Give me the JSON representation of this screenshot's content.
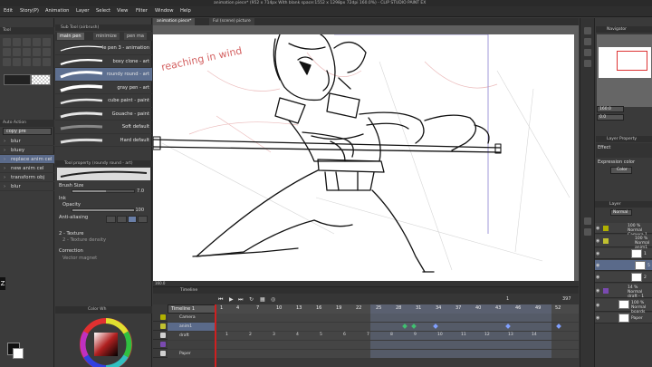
{
  "window": {
    "title": "animation piece* (952 x 714px With blank space:1552 x 1298px 72dpi 160.0%) - CLIP STUDIO PAINT EX"
  },
  "menu": [
    "Edit",
    "Story(P)",
    "Animation",
    "Layer",
    "Select",
    "View",
    "Filter",
    "Window",
    "Help"
  ],
  "tool_panel": {
    "header": "Tool",
    "subtool_header": "Auto Action",
    "subtool_dropdown": "copy pre",
    "items": [
      {
        "label": "blur",
        "selected": false
      },
      {
        "label": "bluey",
        "selected": false
      },
      {
        "label": "replace anim cel",
        "selected": true
      },
      {
        "label": "new anim cel",
        "selected": false
      },
      {
        "label": "transform obj",
        "selected": false
      },
      {
        "label": "blur",
        "selected": false
      }
    ],
    "shortcut_key": "Z"
  },
  "brush_panel": {
    "header": "Sub Tool (airbrush)",
    "tabs": [
      {
        "label": "main pen",
        "selected": true
      },
      {
        "label": "minimize",
        "selected": false
      },
      {
        "label": "pen ma",
        "selected": false
      }
    ],
    "brushes": [
      {
        "label": "le pen 3 - animation",
        "selected": false
      },
      {
        "label": "boxy clone - art",
        "selected": false
      },
      {
        "label": "roundy round - art",
        "selected": true
      },
      {
        "label": "gray pen - art",
        "selected": false
      },
      {
        "label": "cube paint - paint",
        "selected": false
      },
      {
        "label": "Gouache - paint",
        "selected": false
      },
      {
        "label": "Soft default",
        "selected": false
      },
      {
        "label": "Hard default",
        "selected": false
      }
    ]
  },
  "tool_property": {
    "header": "Tool property (roundy round - art)",
    "brush_size_label": "Brush Size",
    "brush_size_value": "7.0",
    "brush_size_fraction": 0.55,
    "ink_label": "Ink",
    "opacity_label": "Opacity",
    "opacity_value": "100",
    "opacity_fraction": 1.0,
    "anti_alias_label": "Anti-aliasing",
    "texture_label": "2 - Texture",
    "texture_density_label": "2 - Texture density",
    "correction_label": "Correction",
    "vector_magnet_label": "Vector magnet"
  },
  "color_wheel": {
    "header": "Color Wh"
  },
  "document_tabs": [
    {
      "label": "animation piece*",
      "selected": true
    },
    {
      "label": "Ful (scene) picture",
      "selected": false
    }
  ],
  "canvas": {
    "zoom": "160.0",
    "handwritten_note": "reaching in wind"
  },
  "timeline": {
    "header": "Timeline",
    "selected_timeline": "Timeline 1",
    "current_frame": "1",
    "total_frames": "397",
    "frame_marks": [
      "1",
      "4",
      "7",
      "10",
      "13",
      "16",
      "19",
      "22",
      "25",
      "28",
      "31",
      "34",
      "37",
      "40",
      "43",
      "46",
      "49",
      "52"
    ],
    "tracks": [
      {
        "name": "Camera",
        "selected": false,
        "badge_color": "#b0b000"
      },
      {
        "name": "anim1",
        "selected": true,
        "badge_color": "#c0c030"
      },
      {
        "name": "draft",
        "selected": false,
        "badge_color": "#d0d0d0"
      },
      {
        "name": "",
        "selected": false,
        "badge_color": "#7a4ab0"
      },
      {
        "name": "Paper",
        "selected": false,
        "badge_color": "#d0d0d0"
      }
    ],
    "draft_cells": [
      "1",
      "2",
      "3",
      "4",
      "5",
      "6",
      "7",
      "8",
      "9",
      "10",
      "11",
      "12",
      "13",
      "14"
    ]
  },
  "navigator": {
    "header": "Navigator",
    "zoom_value": "160.0",
    "angle_value": "0.0"
  },
  "layer_property": {
    "header": "Layer Property",
    "effect_label": "Effect",
    "expression_color_label": "Expression color",
    "expression_color_value": "Color"
  },
  "layers": {
    "header": "Layer",
    "blend_mode": "Normal",
    "items": [
      {
        "name": "100 % Normal Camera 1",
        "selected": false,
        "badge_color": "#b0b000"
      },
      {
        "name": "100 % Normal anim1",
        "selected": false,
        "badge_color": "#c0c030"
      },
      {
        "name": "1",
        "selected": false,
        "badge_color": ""
      },
      {
        "name": "5",
        "selected": true,
        "badge_color": ""
      },
      {
        "name": "2",
        "selected": false,
        "badge_color": ""
      },
      {
        "name": "14 % Normal draft - 1",
        "selected": false,
        "badge_color": "#7a4ab0"
      },
      {
        "name": "100 % Normal boards",
        "selected": false,
        "badge_color": ""
      },
      {
        "name": "Paper",
        "selected": false,
        "badge_color": ""
      }
    ]
  },
  "colors": {
    "accent_selected": "#5a6a8a",
    "keyframe_green": "#40c070",
    "keyframe_blue": "#80a0ff",
    "playhead": "#d02020"
  }
}
